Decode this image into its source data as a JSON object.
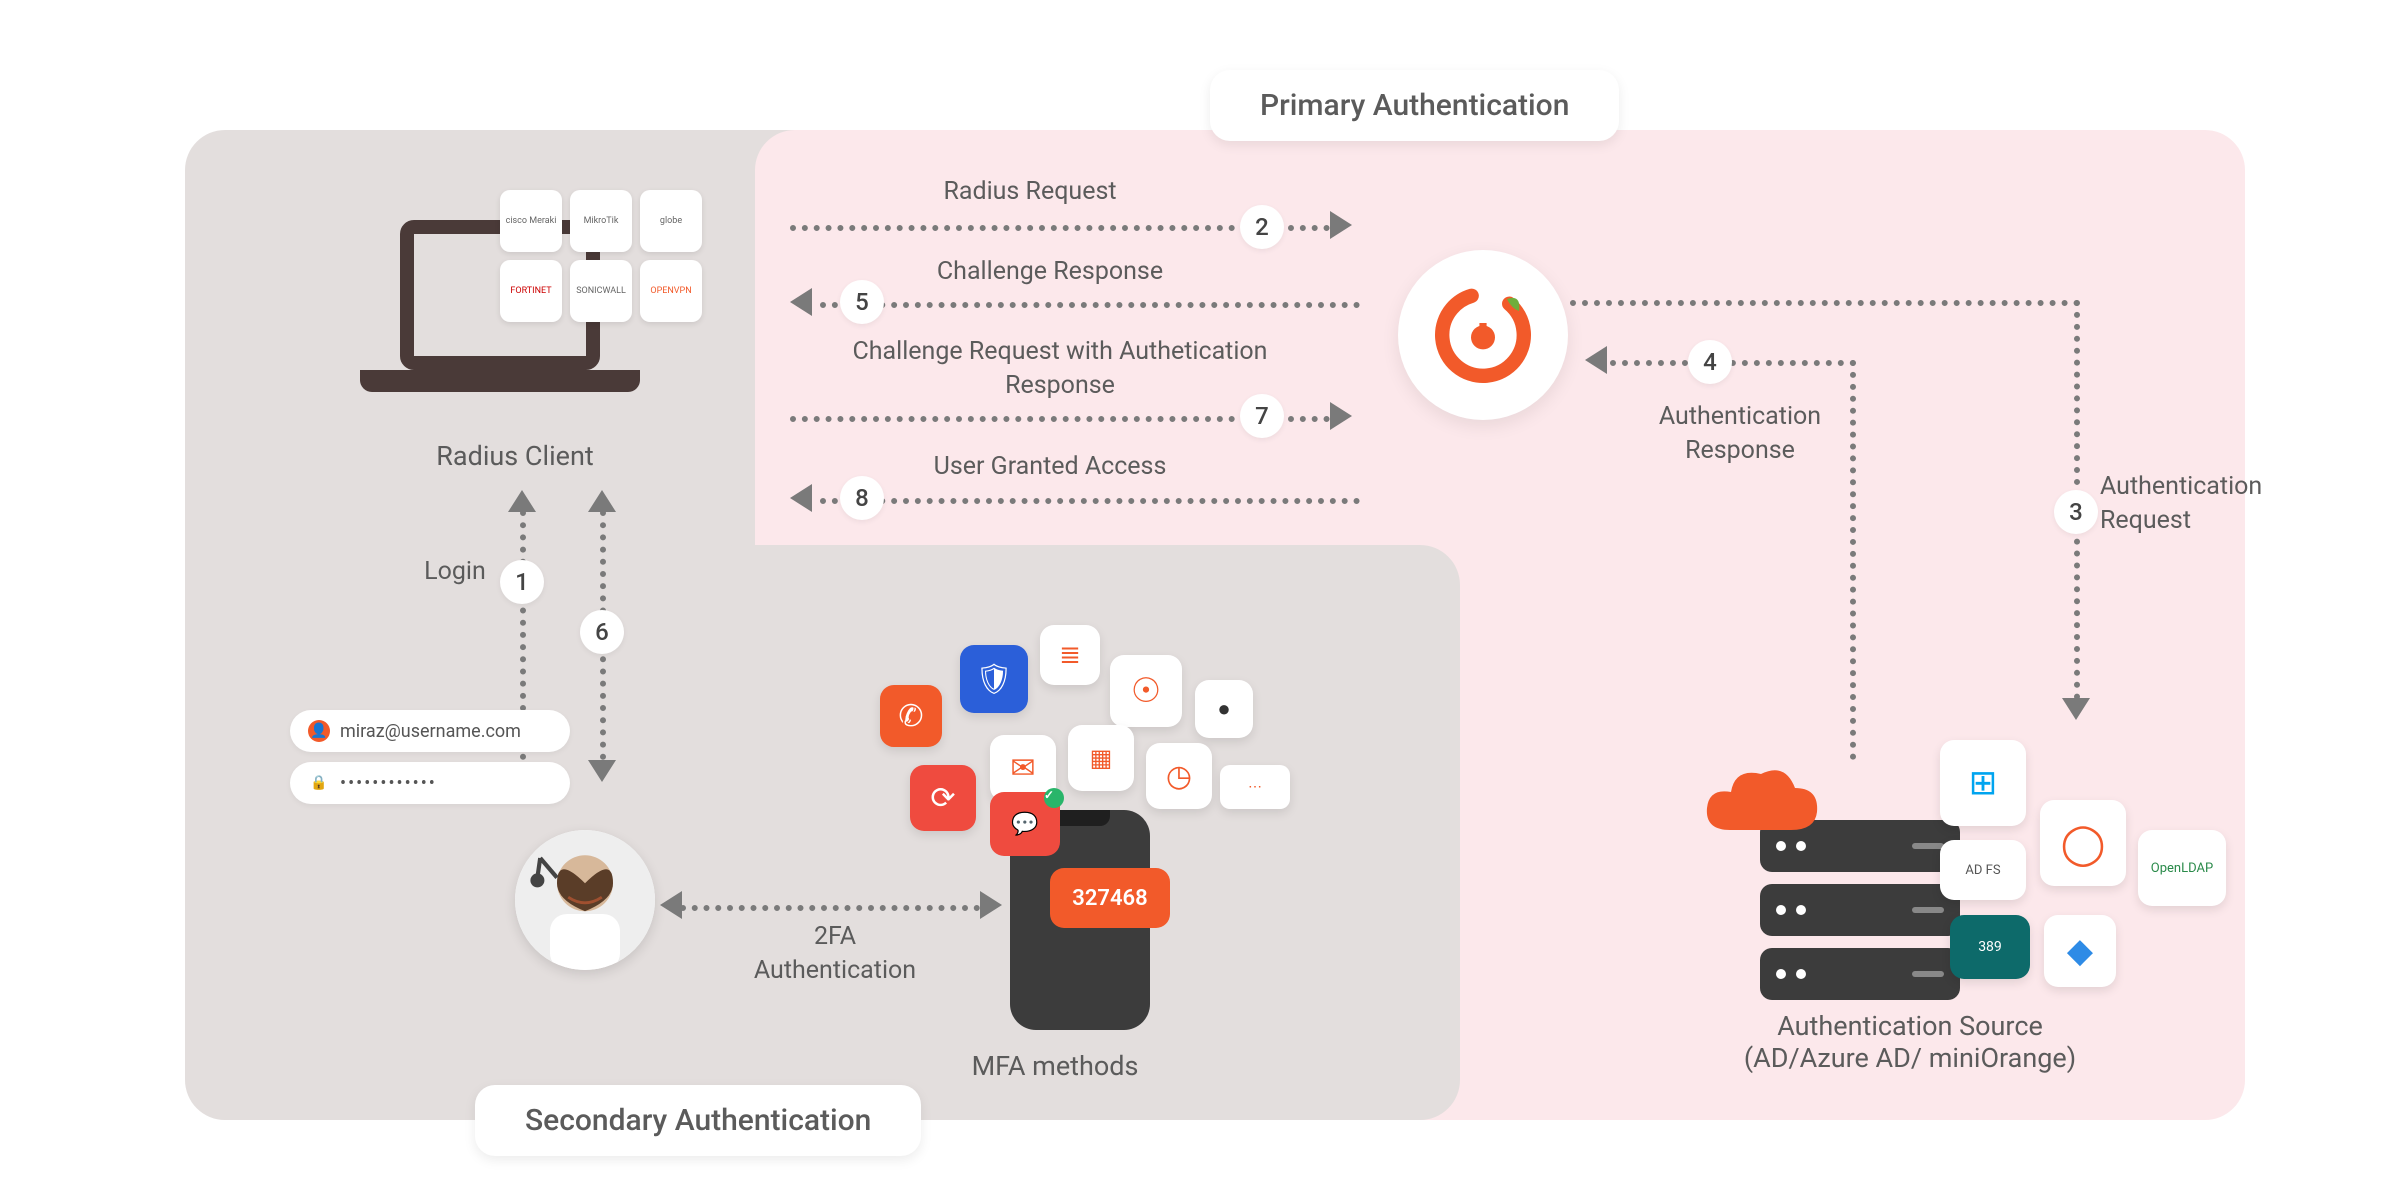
{
  "panels": {
    "primary_title": "Primary Authentication",
    "secondary_title": "Secondary Authentication"
  },
  "nodes": {
    "radius_client_label": "Radius Client",
    "mfa_methods_label": "MFA methods",
    "auth_source_label": "Authentication Source\n(AD/Azure AD/ miniOrange)"
  },
  "login": {
    "username": "miraz@username.com",
    "password_mask": "••••••••••••"
  },
  "mfa_code": "327468",
  "vendor_tiles": [
    "cisco Meraki",
    "MikroTik",
    "globe",
    "FORTINET",
    "SONICWALL",
    "OPENVPN"
  ],
  "auth_tiles": [
    "Windows",
    "AD FS",
    "miniOrange",
    "389",
    "Azure",
    "OpenLDAP"
  ],
  "flows": {
    "login_label": "Login",
    "two_fa_label": "2FA\nAuthentication",
    "f2_label": "Radius Request",
    "f5_label": "Challenge Response",
    "f7_label": "Challenge Request with Authetication\nResponse",
    "f8_label": "User Granted Access",
    "f3_label": "Authentication\nRequest",
    "f4_label": "Authentication\nResponse"
  },
  "steps": {
    "s1": "1",
    "s2": "2",
    "s3": "3",
    "s4": "4",
    "s5": "5",
    "s6": "6",
    "s7": "7",
    "s8": "8"
  },
  "colors": {
    "accent_orange": "#f25a2a",
    "accent_red": "#ef4b3f",
    "panel_gray": "#e3dedd",
    "panel_pink": "#fce8eb",
    "ink": "#5b5b5b"
  }
}
